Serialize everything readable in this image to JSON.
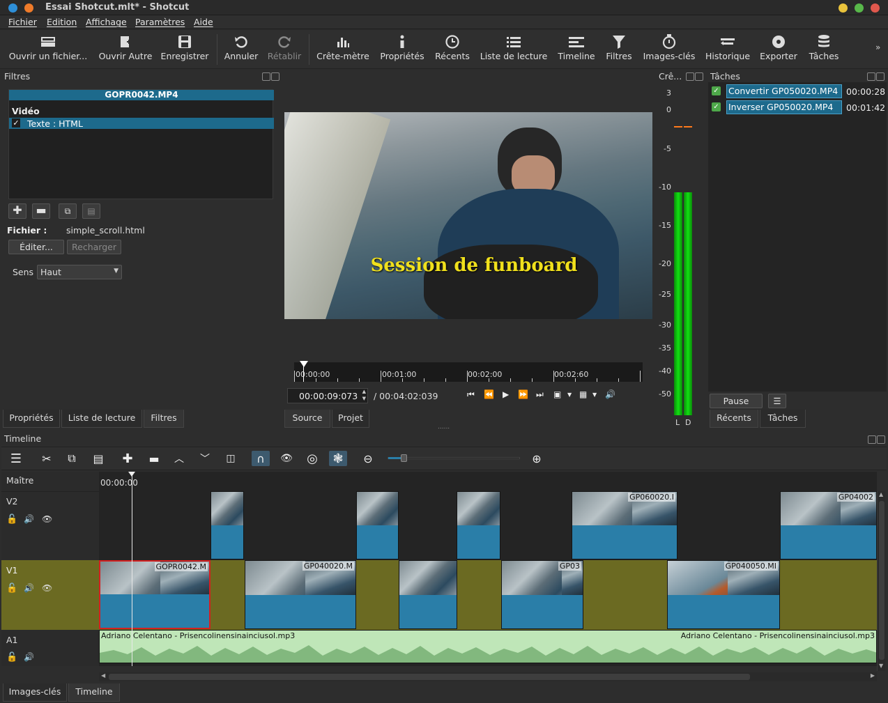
{
  "window": {
    "title": "Essai Shotcut.mlt* - Shotcut"
  },
  "menu": [
    "Fichier",
    "Edition",
    "Affichage",
    "Paramètres",
    "Aide"
  ],
  "toolbar": [
    {
      "label": "Ouvrir un fichier...",
      "icon": "open-file-icon"
    },
    {
      "label": "Ouvrir Autre",
      "icon": "open-other-icon"
    },
    {
      "label": "Enregistrer",
      "icon": "save-icon"
    },
    {
      "label": "Annuler",
      "icon": "undo-icon"
    },
    {
      "label": "Rétablir",
      "icon": "redo-icon",
      "disabled": true
    },
    {
      "label": "Crête-mètre",
      "icon": "peak-meter-icon"
    },
    {
      "label": "Propriétés",
      "icon": "info-icon"
    },
    {
      "label": "Récents",
      "icon": "clock-icon"
    },
    {
      "label": "Liste de lecture",
      "icon": "list-icon"
    },
    {
      "label": "Timeline",
      "icon": "timeline-icon"
    },
    {
      "label": "Filtres",
      "icon": "filter-icon"
    },
    {
      "label": "Images-clés",
      "icon": "stopwatch-icon"
    },
    {
      "label": "Historique",
      "icon": "history-icon"
    },
    {
      "label": "Exporter",
      "icon": "export-icon"
    },
    {
      "label": "Tâches",
      "icon": "jobs-icon"
    }
  ],
  "filters_panel": {
    "header": "Filtres",
    "clip_name": "GOPR0042.MP4",
    "section": "Vidéo",
    "filter_item": "Texte : HTML",
    "file_label": "Fichier :",
    "file_value": "simple_scroll.html",
    "edit_button": "Éditer...",
    "reload_button": "Recharger",
    "direction_label": "Sens",
    "direction_value": "Haut"
  },
  "left_tabs": [
    "Propriétés",
    "Liste de lecture",
    "Filtres"
  ],
  "player": {
    "overlay_text": "Session de funboard",
    "ruler": [
      "00:00:00",
      "00:01:00",
      "00:02:00",
      "00:02:60"
    ],
    "current_time": "00:00:09:073",
    "total_time": "/ 00:04:02:039",
    "tabs": [
      "Source",
      "Projet"
    ]
  },
  "meter": {
    "header": "Crê...",
    "scale": [
      "3",
      "0",
      "-5",
      "-10",
      "-15",
      "-20",
      "-25",
      "-30",
      "-35",
      "-40",
      "-50"
    ],
    "channels": [
      "L",
      "D"
    ]
  },
  "jobs": {
    "header": "Tâches",
    "items": [
      {
        "name": "Convertir GP050020.MP4",
        "time": "00:00:28"
      },
      {
        "name": "Inverser GP050020.MP4",
        "time": "00:01:42"
      }
    ],
    "pause_button": "Pause",
    "tabs": [
      "Récents",
      "Tâches"
    ]
  },
  "timeline": {
    "header": "Timeline",
    "master": "Maître",
    "time_label": "00:00:00",
    "tracks": [
      "V2",
      "V1",
      "A1"
    ],
    "v2_clips": [
      "GP060020.I",
      "GP04002"
    ],
    "v1_clips": [
      "GOPR0042.M",
      "GP040020.M",
      "GP03",
      "GP040050.MI"
    ],
    "audio_clip": "Adriano Celentano - Prisencolinensinainciusol.mp3",
    "audio_clip_end": "Adriano Celentano - Prisencolinensinainciusol.mp3"
  },
  "bottom_tabs": [
    "Images-clés",
    "Timeline"
  ],
  "colors": {
    "accent": "#1d6a8c",
    "clip_blue": "#2a7ea8",
    "gap": "#6b6a22",
    "audio": "#bfe6b8"
  }
}
